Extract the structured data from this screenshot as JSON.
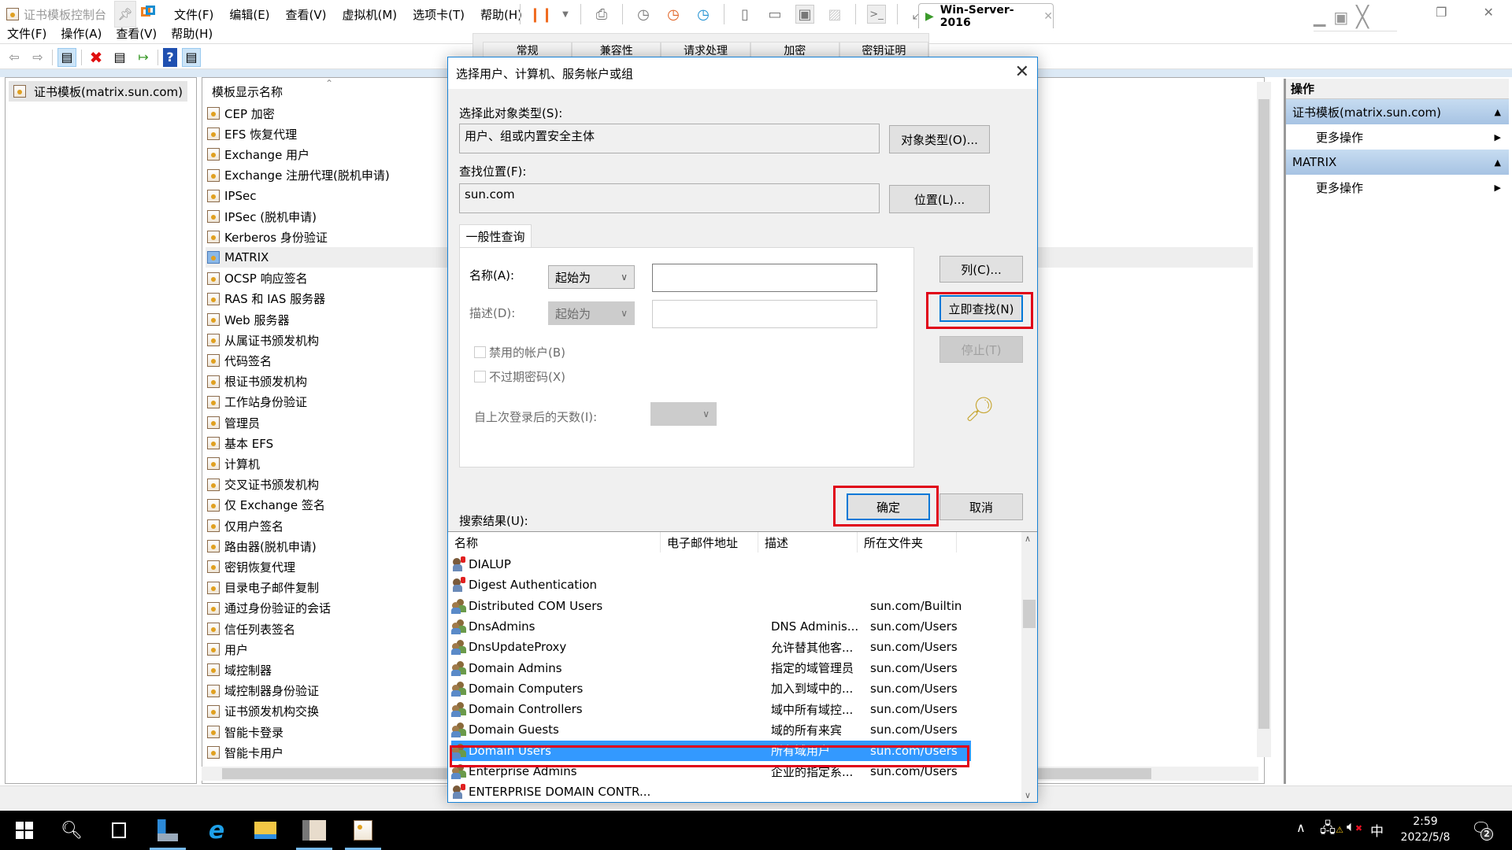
{
  "vmware": {
    "mmc_window_title": "证书模板控制台",
    "menu": [
      "文件(F)",
      "编辑(E)",
      "查看(V)",
      "虚拟机(M)",
      "选项卡(T)",
      "帮助(H)"
    ],
    "vm_tab": "Win-Server-2016"
  },
  "mmc": {
    "menu": [
      "文件(F)",
      "操作(A)",
      "查看(V)",
      "帮助(H)"
    ],
    "tree_root": "证书模板(matrix.sun.com)",
    "list_header": "模板显示名称",
    "templates": [
      "CEP 加密",
      "EFS 恢复代理",
      "Exchange 用户",
      "Exchange 注册代理(脱机申请)",
      "IPSec",
      "IPSec (脱机申请)",
      "Kerberos 身份验证",
      "MATRIX",
      "OCSP 响应签名",
      "RAS 和 IAS 服务器",
      "Web 服务器",
      "从属证书颁发机构",
      "代码签名",
      "根证书颁发机构",
      "工作站身份验证",
      "管理员",
      "基本 EFS",
      "计算机",
      "交叉证书颁发机构",
      "仅 Exchange 签名",
      "仅用户签名",
      "路由器(脱机申请)",
      "密钥恢复代理",
      "目录电子邮件复制",
      "通过身份验证的会话",
      "信任列表签名",
      "用户",
      "域控制器",
      "域控制器身份验证",
      "证书颁发机构交换",
      "智能卡登录",
      "智能卡用户"
    ],
    "selected_template": "MATRIX",
    "property_tabs": [
      "常规",
      "兼容性",
      "请求处理",
      "加密",
      "密钥证明"
    ],
    "actions": {
      "header": "操作",
      "groups": [
        {
          "title": "证书模板(matrix.sun.com)",
          "item": "更多操作"
        },
        {
          "title": "MATRIX",
          "item": "更多操作"
        }
      ]
    }
  },
  "dialog": {
    "title": "选择用户、计算机、服务帐户或组",
    "object_type_label": "选择此对象类型(S):",
    "object_type_value": "用户、组或内置安全主体",
    "object_type_button": "对象类型(O)...",
    "location_label": "查找位置(F):",
    "location_value": "sun.com",
    "location_button": "位置(L)...",
    "query_tab": "一般性查询",
    "name_label": "名称(A):",
    "name_mode": "起始为",
    "name_value": "",
    "desc_label": "描述(D):",
    "desc_mode": "起始为",
    "desc_value": "",
    "disabled_accounts": {
      "label": "禁用的帐户(B)",
      "checked": false
    },
    "non_expiring_pw": {
      "label": "不过期密码(X)",
      "checked": false
    },
    "days_since_logon_label": "自上次登录后的天数(I):",
    "days_since_logon_value": "",
    "columns_button": "列(C)...",
    "find_now_button": "立即查找(N)",
    "stop_button": "停止(T)",
    "ok_button": "确定",
    "cancel_button": "取消",
    "results_label": "搜索结果(U):",
    "results_columns": [
      "名称",
      "电子邮件地址",
      "描述",
      "所在文件夹"
    ],
    "results": [
      {
        "name": "DIALUP",
        "email": "",
        "desc": "",
        "folder": "",
        "icon": "special"
      },
      {
        "name": "Digest Authentication",
        "email": "",
        "desc": "",
        "folder": "",
        "icon": "special"
      },
      {
        "name": "Distributed COM Users",
        "email": "",
        "desc": "",
        "folder": "sun.com/Builtin",
        "icon": "group"
      },
      {
        "name": "DnsAdmins",
        "email": "",
        "desc": "DNS Adminis...",
        "folder": "sun.com/Users",
        "icon": "group"
      },
      {
        "name": "DnsUpdateProxy",
        "email": "",
        "desc": "允许替其他客...",
        "folder": "sun.com/Users",
        "icon": "group"
      },
      {
        "name": "Domain Admins",
        "email": "",
        "desc": "指定的域管理员",
        "folder": "sun.com/Users",
        "icon": "group"
      },
      {
        "name": "Domain Computers",
        "email": "",
        "desc": "加入到域中的...",
        "folder": "sun.com/Users",
        "icon": "group"
      },
      {
        "name": "Domain Controllers",
        "email": "",
        "desc": "域中所有域控...",
        "folder": "sun.com/Users",
        "icon": "group"
      },
      {
        "name": "Domain Guests",
        "email": "",
        "desc": "域的所有来宾",
        "folder": "sun.com/Users",
        "icon": "group"
      },
      {
        "name": "Domain Users",
        "email": "",
        "desc": "所有域用户",
        "folder": "sun.com/Users",
        "icon": "group",
        "selected": true
      },
      {
        "name": "Enterprise Admins",
        "email": "",
        "desc": "企业的指定系...",
        "folder": "sun.com/Users",
        "icon": "group"
      },
      {
        "name": "ENTERPRISE DOMAIN CONTR...",
        "email": "",
        "desc": "",
        "folder": "",
        "icon": "special"
      }
    ],
    "highlight_color": "#e00018",
    "selection_color": "#3399ff"
  },
  "taskbar": {
    "time": "2:59",
    "date": "2022/5/8",
    "ime": "中",
    "notifications": "2"
  }
}
